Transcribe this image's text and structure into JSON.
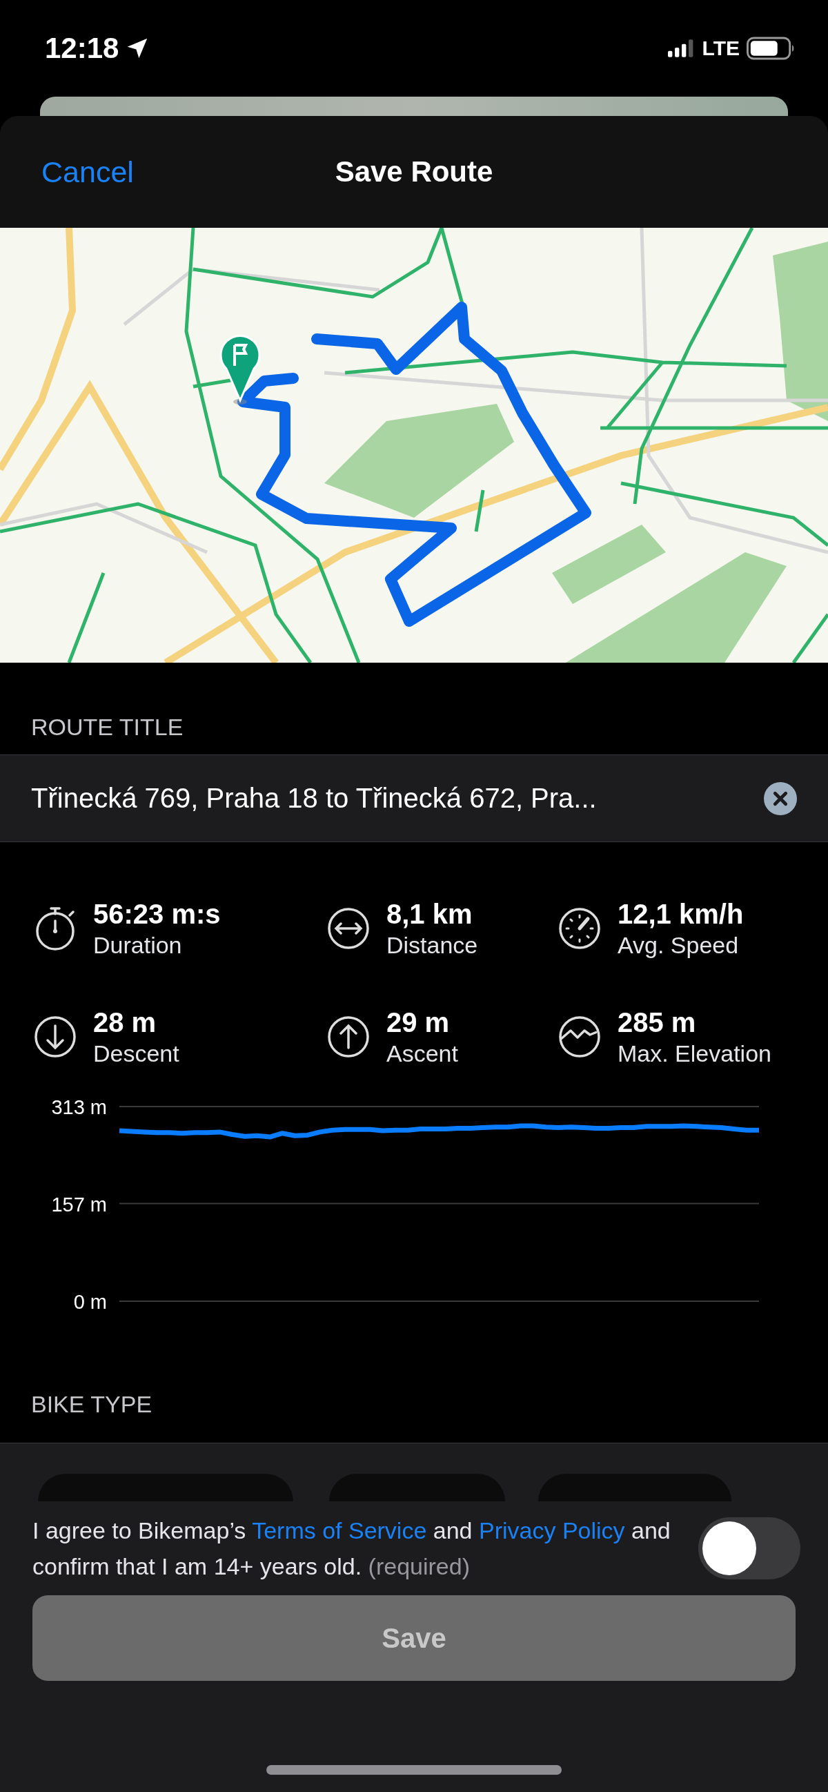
{
  "status_bar": {
    "time": "12:18",
    "network": "LTE"
  },
  "header": {
    "cancel": "Cancel",
    "title": "Save Route"
  },
  "route_title": {
    "label": "ROUTE TITLE",
    "value": "Třinecká 769, Praha 18 to Třinecká 672, Pra..."
  },
  "stats": [
    {
      "kind": "timer",
      "value": "56:23 m:s",
      "label": "Duration"
    },
    {
      "kind": "distance",
      "value": "8,1 km",
      "label": "Distance"
    },
    {
      "kind": "speed",
      "value": "12,1 km/h",
      "label": "Avg. Speed"
    },
    {
      "kind": "descent",
      "value": "28 m",
      "label": "Descent"
    },
    {
      "kind": "ascent",
      "value": "29 m",
      "label": "Ascent"
    },
    {
      "kind": "elevation",
      "value": "285 m",
      "label": "Max. Elevation"
    }
  ],
  "elevation": {
    "chart_data": {
      "type": "line",
      "ylim": [
        0,
        313
      ],
      "yticks": [
        {
          "value": 0,
          "label": "0 m"
        },
        {
          "value": 157,
          "label": "157 m"
        },
        {
          "value": 313,
          "label": "313 m"
        }
      ],
      "series": [
        {
          "color": "#0a7cff",
          "values": [
            274,
            273,
            272,
            271,
            271,
            270,
            271,
            271,
            272,
            268,
            265,
            266,
            264,
            270,
            266,
            267,
            272,
            275,
            276,
            276,
            276,
            274,
            275,
            275,
            277,
            277,
            277,
            278,
            278,
            279,
            280,
            280,
            282,
            282,
            280,
            279,
            280,
            279,
            278,
            278,
            279,
            279,
            281,
            281,
            281,
            282,
            281,
            280,
            279,
            277,
            275,
            275
          ]
        }
      ]
    }
  },
  "bike_type": {
    "label": "BIKE TYPE"
  },
  "agreement": {
    "on": false,
    "parts": [
      {
        "kind": "text",
        "text": "I agree to Bikemap’s "
      },
      {
        "kind": "link",
        "text": "Terms of Service"
      },
      {
        "kind": "text",
        "text": " and "
      },
      {
        "kind": "link",
        "text": "Privacy Policy"
      },
      {
        "kind": "text",
        "text": " and confirm that I am 14+ years old. "
      },
      {
        "kind": "note",
        "text": "(required)"
      }
    ]
  },
  "save_button": {
    "label": "Save",
    "disabled": true
  }
}
